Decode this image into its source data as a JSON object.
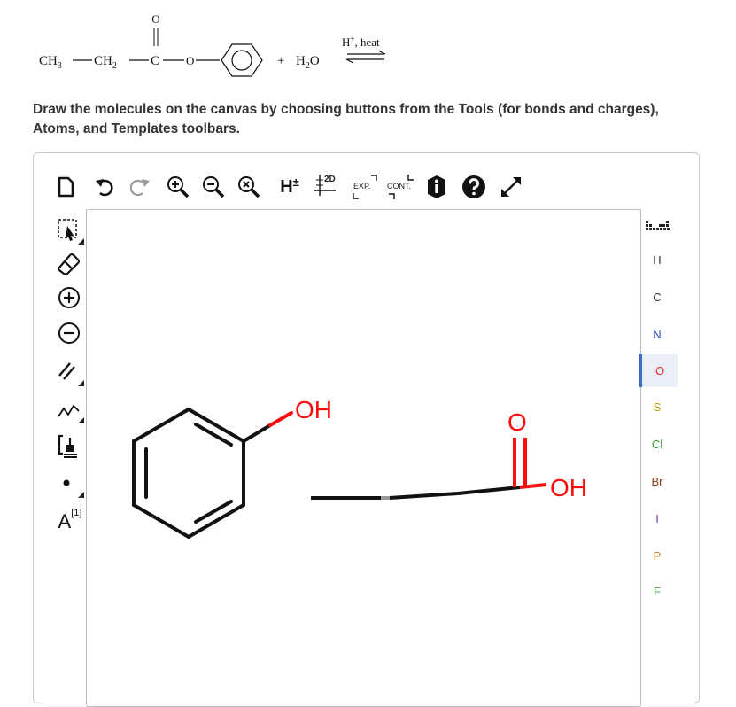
{
  "reaction": {
    "carbonyl_o": "O",
    "ch3": "CH",
    "ch3_sub": "3",
    "ch2": "CH",
    "ch2_sub": "2",
    "c": "C",
    "o": "O",
    "plus": "+",
    "water_h": "H",
    "water_sub": "2",
    "water_o": "O",
    "condition_h": "H",
    "condition_sup": "+",
    "condition_rest": ", heat"
  },
  "instructions": {
    "line1": "Draw the molecules on the canvas by choosing buttons from the Tools (for bonds and charges),",
    "line2": "Atoms, and Templates toolbars."
  },
  "top_toolbar": {
    "h_label": "H",
    "h_sup": "±",
    "two_d_label": "2D",
    "exp_label": "EXP.",
    "cont_label": "CONT."
  },
  "left_toolbar": {
    "label_tool": "A",
    "label_tool_sup": "[1]"
  },
  "atoms": [
    {
      "symbol": "H",
      "color": "#333333",
      "selected": false
    },
    {
      "symbol": "C",
      "color": "#333333",
      "selected": false
    },
    {
      "symbol": "N",
      "color": "#2f4fbf",
      "selected": false
    },
    {
      "symbol": "O",
      "color": "#e0241b",
      "selected": true
    },
    {
      "symbol": "S",
      "color": "#b29a00",
      "selected": false
    },
    {
      "symbol": "Cl",
      "color": "#2f9e2f",
      "selected": false
    },
    {
      "symbol": "Br",
      "color": "#8b3a1a",
      "selected": false
    },
    {
      "symbol": "I",
      "color": "#7b2ea8",
      "selected": false
    },
    {
      "symbol": "P",
      "color": "#d9822b",
      "selected": false
    },
    {
      "symbol": "F",
      "color": "#4aa54a",
      "selected": false
    }
  ],
  "canvas": {
    "phenol_oh": "OH",
    "acid_o": "O",
    "acid_oh": "OH",
    "oxygen_color": "#ff0d0d",
    "bond_color": "#111111"
  }
}
